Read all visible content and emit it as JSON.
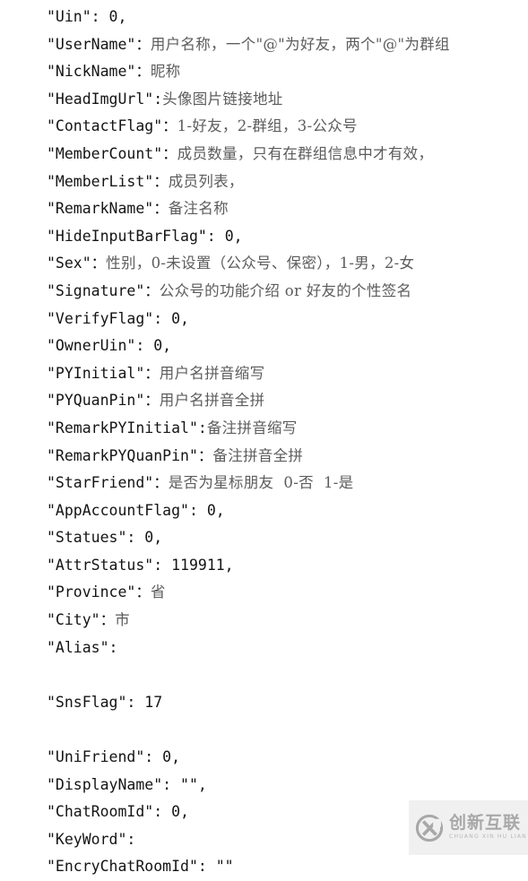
{
  "document": {
    "type": "code-snippet",
    "language": "json",
    "background_color": "#ffffff",
    "ascii_text_color": "#141414",
    "cjk_text_color": "#5c5c5c",
    "lines": [
      {
        "id": "uin",
        "key": "\"Uin\": ",
        "value": "0,",
        "value_kind": "ascii"
      },
      {
        "id": "username",
        "key": "\"UserName\"：",
        "value": "用户名称，一个\"@\"为好友，两个\"@\"为群组",
        "value_kind": "cjk"
      },
      {
        "id": "nickname",
        "key": "\"NickName\"：",
        "value": "昵称",
        "value_kind": "cjk"
      },
      {
        "id": "headimgurl",
        "key": "\"HeadImgUrl\":",
        "value": "头像图片链接地址",
        "value_kind": "cjk"
      },
      {
        "id": "contactflag",
        "key": "\"ContactFlag\"：",
        "value": "1-好友，2-群组，3-公众号",
        "value_kind": "cjk"
      },
      {
        "id": "membercount",
        "key": "\"MemberCount\"：",
        "value": "成员数量，只有在群组信息中才有效，",
        "value_kind": "cjk"
      },
      {
        "id": "memberlist",
        "key": "\"MemberList\"：",
        "value": "成员列表，",
        "value_kind": "cjk"
      },
      {
        "id": "remarkname",
        "key": "\"RemarkName\"：",
        "value": "备注名称",
        "value_kind": "cjk"
      },
      {
        "id": "hideinputbarflag",
        "key": "\"HideInputBarFlag\": ",
        "value": "0,",
        "value_kind": "ascii"
      },
      {
        "id": "sex",
        "key": "\"Sex\"：",
        "value": "性别，0-未设置（公众号、保密），1-男，2-女",
        "value_kind": "cjk"
      },
      {
        "id": "signature",
        "key": "\"Signature\"：",
        "value": "公众号的功能介绍 or 好友的个性签名",
        "value_kind": "cjk"
      },
      {
        "id": "verifyflag",
        "key": "\"VerifyFlag\": ",
        "value": "0,",
        "value_kind": "ascii"
      },
      {
        "id": "owneruin",
        "key": "\"OwnerUin\": ",
        "value": "0,",
        "value_kind": "ascii"
      },
      {
        "id": "pyinitial",
        "key": "\"PYInitial\"：",
        "value": "用户名拼音缩写",
        "value_kind": "cjk"
      },
      {
        "id": "pyquanpin",
        "key": "\"PYQuanPin\"：",
        "value": "用户名拼音全拼",
        "value_kind": "cjk"
      },
      {
        "id": "remarkpyinitial",
        "key": "\"RemarkPYInitial\":",
        "value": "备注拼音缩写",
        "value_kind": "cjk"
      },
      {
        "id": "remarkpyquanpin",
        "key": "\"RemarkPYQuanPin\"：",
        "value": "备注拼音全拼",
        "value_kind": "cjk"
      },
      {
        "id": "starfriend",
        "key": "\"StarFriend\"：",
        "value": "是否为星标朋友  0-否  1-是",
        "value_kind": "cjk"
      },
      {
        "id": "appaccountflag",
        "key": "\"AppAccountFlag\": ",
        "value": "0,",
        "value_kind": "ascii"
      },
      {
        "id": "statues",
        "key": "\"Statues\": ",
        "value": "0,",
        "value_kind": "ascii"
      },
      {
        "id": "attrstatus",
        "key": "\"AttrStatus\": ",
        "value": "119911,",
        "value_kind": "ascii"
      },
      {
        "id": "province",
        "key": "\"Province\"：",
        "value": "省",
        "value_kind": "cjk"
      },
      {
        "id": "city",
        "key": "\"City\"：",
        "value": "市",
        "value_kind": "cjk"
      },
      {
        "id": "alias",
        "key": "\"Alias\":",
        "value": "",
        "value_kind": "ascii"
      },
      {
        "id": "blank-1",
        "key": "",
        "value": "",
        "value_kind": "blank"
      },
      {
        "id": "snsflag",
        "key": "\"SnsFlag\": ",
        "value": "17",
        "value_kind": "ascii"
      },
      {
        "id": "blank-2",
        "key": "",
        "value": "",
        "value_kind": "blank"
      },
      {
        "id": "unifriend",
        "key": "\"UniFriend\": ",
        "value": "0,",
        "value_kind": "ascii"
      },
      {
        "id": "displayname",
        "key": "\"DisplayName\": ",
        "value": "\"\",",
        "value_kind": "ascii"
      },
      {
        "id": "chatroomid",
        "key": "\"ChatRoomId\": ",
        "value": "0,",
        "value_kind": "ascii"
      },
      {
        "id": "keyword",
        "key": "\"KeyWord\":",
        "value": "",
        "value_kind": "ascii"
      },
      {
        "id": "encrychatroomid",
        "key": "\"EncryChatRoomId\": ",
        "value": "\"\"",
        "value_kind": "ascii"
      }
    ]
  },
  "watermark": {
    "logo_icon": "circled-x-icon",
    "brand_cn": "创新互联",
    "brand_pinyin": "CHUANG XIN HU LIAN",
    "color": "#a8a8a8",
    "background_color": "#f0f0f0"
  }
}
